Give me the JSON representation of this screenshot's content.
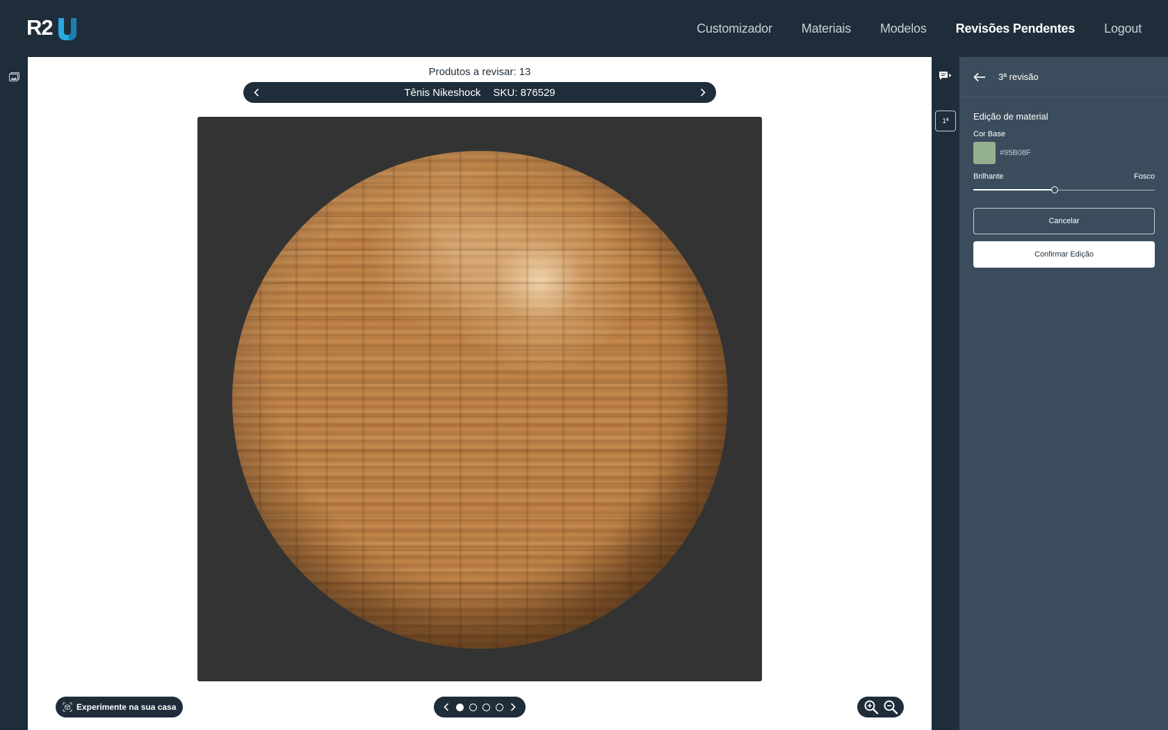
{
  "app": {
    "logo_text": "R2U",
    "brand_accent": "#29a9e0"
  },
  "nav": {
    "items": [
      {
        "label": "Customizador",
        "active": false
      },
      {
        "label": "Materiais",
        "active": false
      },
      {
        "label": "Modelos",
        "active": false
      },
      {
        "label": "Revisões Pendentes",
        "active": true
      },
      {
        "label": "Logout",
        "active": false
      }
    ]
  },
  "viewer": {
    "counter_text": "Produtos a revisar: 13",
    "product_name": "Tênis Nikeshock",
    "sku": "SKU: 876529",
    "ar_button_label": "Experimente na sua casa",
    "pager": {
      "count": 4,
      "active_index": 0
    },
    "viewport_bg": "#333333"
  },
  "revisions": {
    "badge": "1ª"
  },
  "panel": {
    "title": "3ª revisão",
    "section_title": "Edição de material",
    "base_color_label": "Cor Base",
    "base_color_hex": "#95B08F",
    "slider_left_label": "Brilhante",
    "slider_right_label": "Fosco",
    "slider_value": 0.45,
    "cancel_label": "Cancelar",
    "confirm_label": "Confirmar Edição"
  },
  "colors": {
    "dark_navy": "#1f2d3a",
    "panel_bg": "#3b4d5c",
    "white": "#ffffff"
  }
}
